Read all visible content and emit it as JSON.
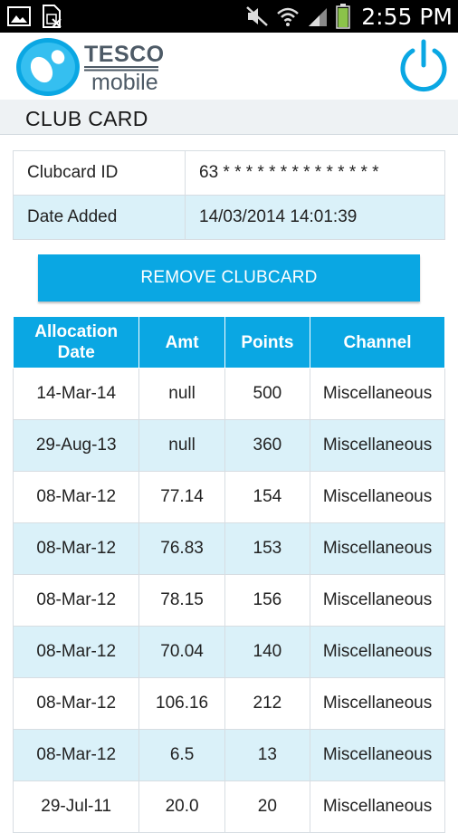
{
  "status_bar": {
    "time": "2:55 PM",
    "icons": [
      "image-icon",
      "sim-card-icon",
      "mute-icon",
      "wifi-icon",
      "signal-icon",
      "battery-icon"
    ]
  },
  "header": {
    "logo_brand": "TESCO",
    "logo_sub": "mobile",
    "power_icon": "power-icon",
    "accent_color": "#0aa7e3"
  },
  "page": {
    "title": "CLUB CARD"
  },
  "card_info": {
    "rows": [
      {
        "label": "Clubcard ID",
        "value": "63 * * * * * * * * * * * * * *"
      },
      {
        "label": "Date Added",
        "value": "14/03/2014 14:01:39"
      }
    ]
  },
  "actions": {
    "remove_label": "REMOVE CLUBCARD"
  },
  "points_table": {
    "headers": [
      "Allocation\nDate",
      "Amt",
      "Points",
      "Channel"
    ],
    "rows": [
      [
        "14-Mar-14",
        "null",
        "500",
        "Miscellaneous"
      ],
      [
        "29-Aug-13",
        "null",
        "360",
        "Miscellaneous"
      ],
      [
        "08-Mar-12",
        "77.14",
        "154",
        "Miscellaneous"
      ],
      [
        "08-Mar-12",
        "76.83",
        "153",
        "Miscellaneous"
      ],
      [
        "08-Mar-12",
        "78.15",
        "156",
        "Miscellaneous"
      ],
      [
        "08-Mar-12",
        "70.04",
        "140",
        "Miscellaneous"
      ],
      [
        "08-Mar-12",
        "106.16",
        "212",
        "Miscellaneous"
      ],
      [
        "08-Mar-12",
        "6.5",
        "13",
        "Miscellaneous"
      ],
      [
        "29-Jul-11",
        "20.0",
        "20",
        "Miscellaneous"
      ]
    ]
  }
}
